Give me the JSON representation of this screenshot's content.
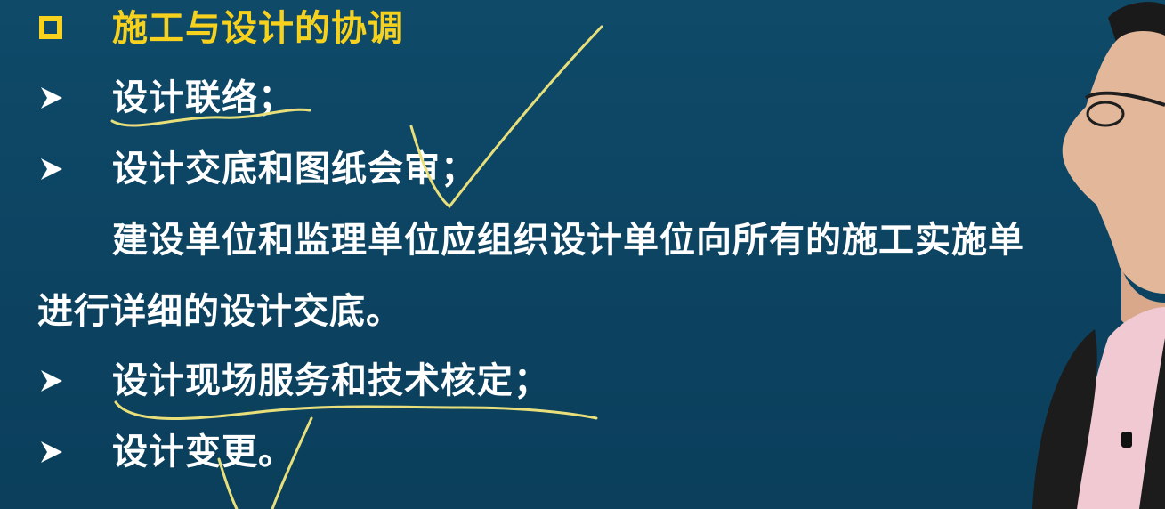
{
  "slide": {
    "title": "施工与设计的协调",
    "items": [
      {
        "bullet": "arrow",
        "text": "设计联络；"
      },
      {
        "bullet": "arrow",
        "text": "设计交底和图纸会审；"
      },
      {
        "bullet": "none",
        "text": "建设单位和监理单位应组织设计单位向所有的施工实施单"
      },
      {
        "bullet": "none",
        "text": "进行详细的设计交底。"
      },
      {
        "bullet": "arrow",
        "text": "设计现场服务和技术核定；"
      },
      {
        "bullet": "arrow",
        "text": "设计变更。"
      }
    ]
  },
  "colors": {
    "background": "#0d4462",
    "title": "#f6d21f",
    "text": "#ffffff",
    "annotation": "#e8df7a"
  }
}
